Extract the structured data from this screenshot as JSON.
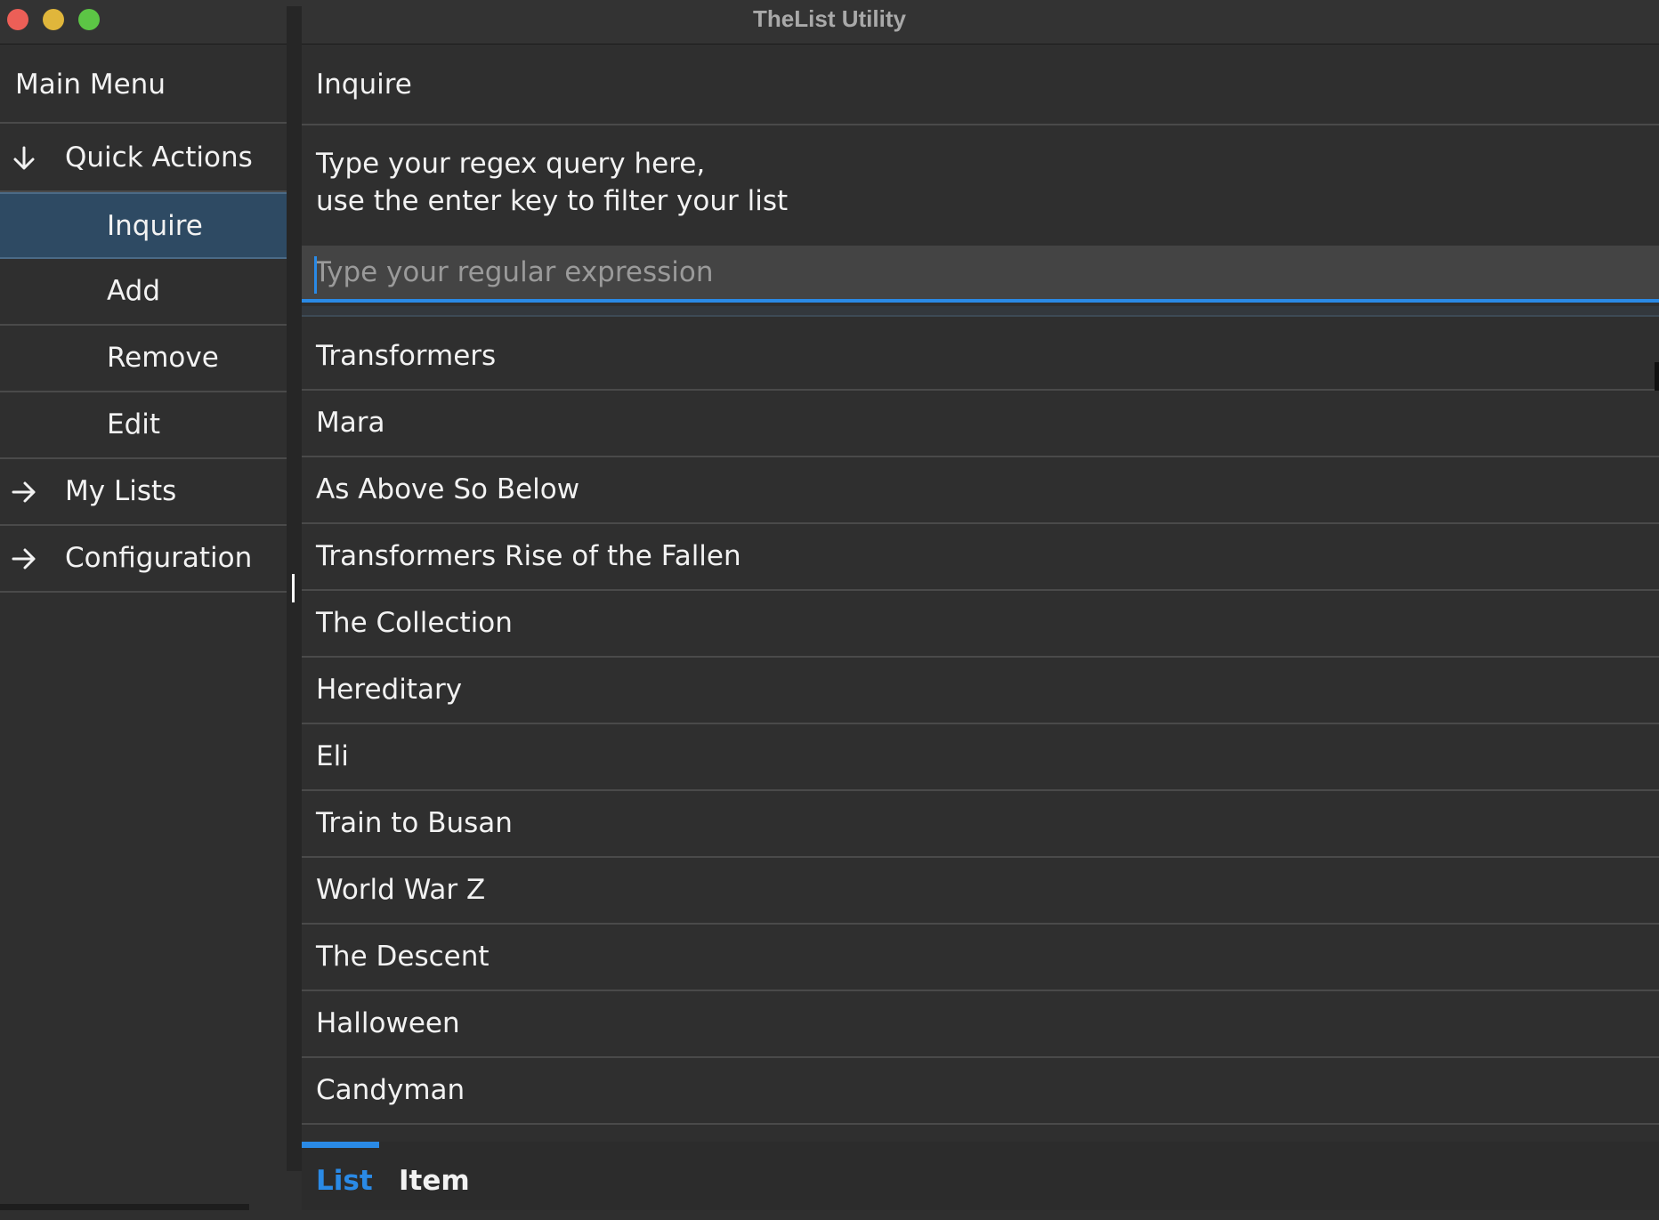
{
  "window": {
    "title": "TheList Utility"
  },
  "sidebar": {
    "header": "Main Menu",
    "items": [
      {
        "label": "Quick Actions",
        "icon": "arrow-down-icon",
        "expanded": true
      },
      {
        "label": "Inquire",
        "selected": true
      },
      {
        "label": "Add"
      },
      {
        "label": "Remove"
      },
      {
        "label": "Edit"
      },
      {
        "label": "My Lists",
        "icon": "arrow-right-icon"
      },
      {
        "label": "Configuration",
        "icon": "arrow-right-icon"
      }
    ]
  },
  "main": {
    "title": "Inquire",
    "instructions": {
      "line1": "Type your regex query here,",
      "line2": "use the enter key to filter your list"
    },
    "search": {
      "placeholder": "Type your regular expression",
      "value": ""
    },
    "results": [
      "Transformers",
      "Mara",
      "As Above So Below",
      "Transformers Rise of the Fallen",
      "The Collection",
      "Hereditary",
      "Eli",
      "Train to Busan",
      "World War Z",
      "The Descent",
      "Halloween",
      "Candyman"
    ],
    "tabs": [
      {
        "label": "List",
        "active": true
      },
      {
        "label": "Item"
      }
    ]
  },
  "colors": {
    "accent": "#2a8ae6",
    "selected_bg": "#2e4a63",
    "background": "#2f2f2f"
  }
}
